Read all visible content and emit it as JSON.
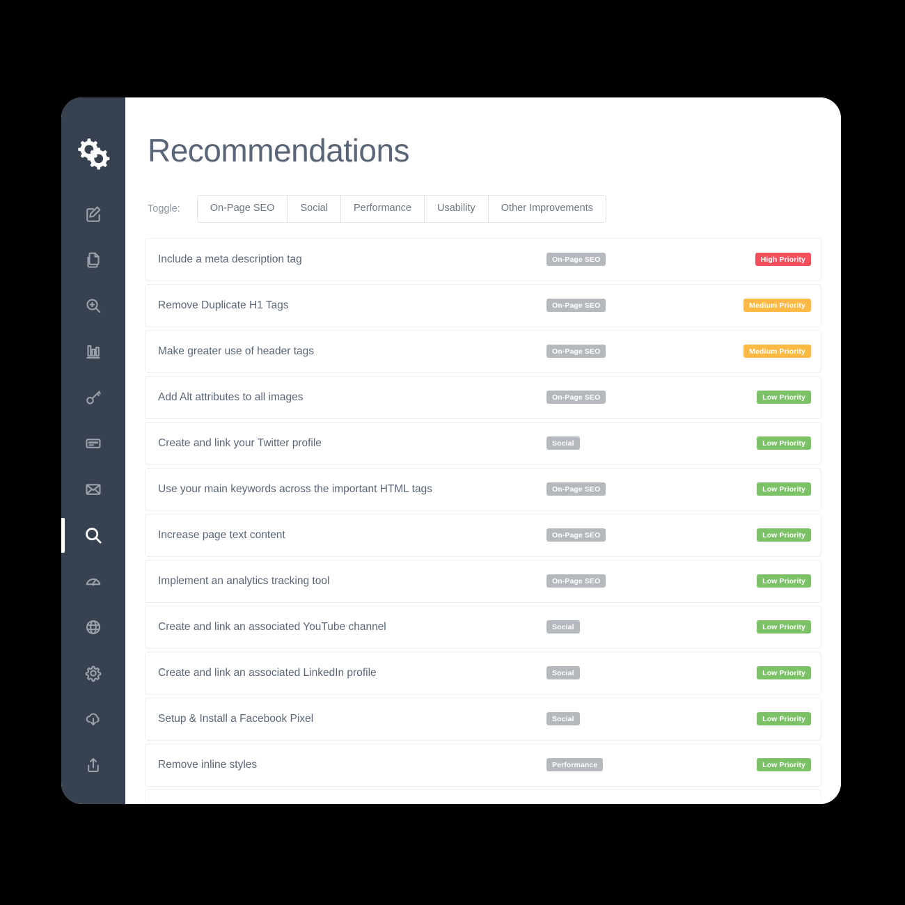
{
  "window": {
    "title": "Recommendations"
  },
  "sidebar": {
    "logo": {
      "name": "gears-logo",
      "label": "Gears Logo"
    },
    "items": [
      {
        "icon": "edit-square-icon",
        "label": "Edit"
      },
      {
        "icon": "copy-pages-icon",
        "label": "Pages"
      },
      {
        "icon": "zoom-in-icon",
        "label": "Inspect"
      },
      {
        "icon": "bar-chart-icon",
        "label": "Analytics"
      },
      {
        "icon": "key-icon",
        "label": "Keywords"
      },
      {
        "icon": "card-icon",
        "label": "Billing"
      },
      {
        "icon": "envelope-icon",
        "label": "Mail"
      },
      {
        "icon": "search-icon",
        "label": "Search",
        "active": true
      },
      {
        "icon": "speedometer-icon",
        "label": "Speed"
      },
      {
        "icon": "globe-icon",
        "label": "Site"
      },
      {
        "icon": "gear-icon",
        "label": "Settings"
      },
      {
        "icon": "cloud-download-icon",
        "label": "Download"
      },
      {
        "icon": "upload-icon",
        "label": "Upload"
      }
    ]
  },
  "toggle": {
    "label": "Toggle:",
    "options": [
      "On-Page SEO",
      "Social",
      "Performance",
      "Usability",
      "Other Improvements"
    ]
  },
  "colors": {
    "sidebar_bg": "#374150",
    "high_priority": "#f4505e",
    "medium_priority": "#fcb944",
    "low_priority": "#7bc267",
    "category_badge": "#b5b8bc",
    "title_text": "#5a6677"
  },
  "recommendations": [
    {
      "title": "Include a meta description tag",
      "category": "On-Page SEO",
      "priority": "High Priority",
      "priority_level": "high"
    },
    {
      "title": "Remove Duplicate H1 Tags",
      "category": "On-Page SEO",
      "priority": "Medium Priority",
      "priority_level": "medium"
    },
    {
      "title": "Make greater use of header tags",
      "category": "On-Page SEO",
      "priority": "Medium Priority",
      "priority_level": "medium"
    },
    {
      "title": "Add Alt attributes to all images",
      "category": "On-Page SEO",
      "priority": "Low Priority",
      "priority_level": "low"
    },
    {
      "title": "Create and link your Twitter profile",
      "category": "Social",
      "priority": "Low Priority",
      "priority_level": "low"
    },
    {
      "title": "Use your main keywords across the important HTML tags",
      "category": "On-Page SEO",
      "priority": "Low Priority",
      "priority_level": "low"
    },
    {
      "title": "Increase page text content",
      "category": "On-Page SEO",
      "priority": "Low Priority",
      "priority_level": "low"
    },
    {
      "title": "Implement an analytics tracking tool",
      "category": "On-Page SEO",
      "priority": "Low Priority",
      "priority_level": "low"
    },
    {
      "title": "Create and link an associated YouTube channel",
      "category": "Social",
      "priority": "Low Priority",
      "priority_level": "low"
    },
    {
      "title": "Create and link an associated LinkedIn profile",
      "category": "Social",
      "priority": "Low Priority",
      "priority_level": "low"
    },
    {
      "title": "Setup & Install a Facebook Pixel",
      "category": "Social",
      "priority": "Low Priority",
      "priority_level": "low"
    },
    {
      "title": "Remove inline styles",
      "category": "Performance",
      "priority": "Low Priority",
      "priority_level": "low"
    }
  ]
}
